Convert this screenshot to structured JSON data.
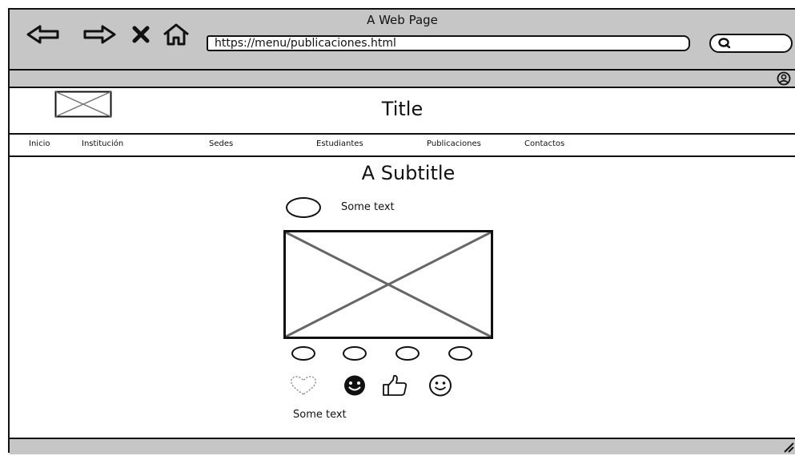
{
  "window": {
    "title": "A Web Page"
  },
  "browser": {
    "url": "https://menu/publicaciones.html"
  },
  "icons": {
    "back": "back-arrow-icon",
    "forward": "forward-arrow-icon",
    "close": "close-icon",
    "home": "home-icon",
    "search": "search-icon",
    "user": "user-icon",
    "logo": "image-placeholder-icon",
    "resize": "resize-grip-icon"
  },
  "header": {
    "title": "Title"
  },
  "menu": {
    "items": [
      "Inicio",
      "Institución",
      "Sedes",
      "Estudiantes",
      "Publicaciones",
      "Contactos"
    ]
  },
  "post": {
    "subtitle": "A Subtitle",
    "author_text": "Some text",
    "carousel_count": 4,
    "reactions": [
      "heart-icon",
      "smiley-filled-icon",
      "thumbs-up-icon",
      "smiley-icon"
    ],
    "caption": "Some text"
  }
}
